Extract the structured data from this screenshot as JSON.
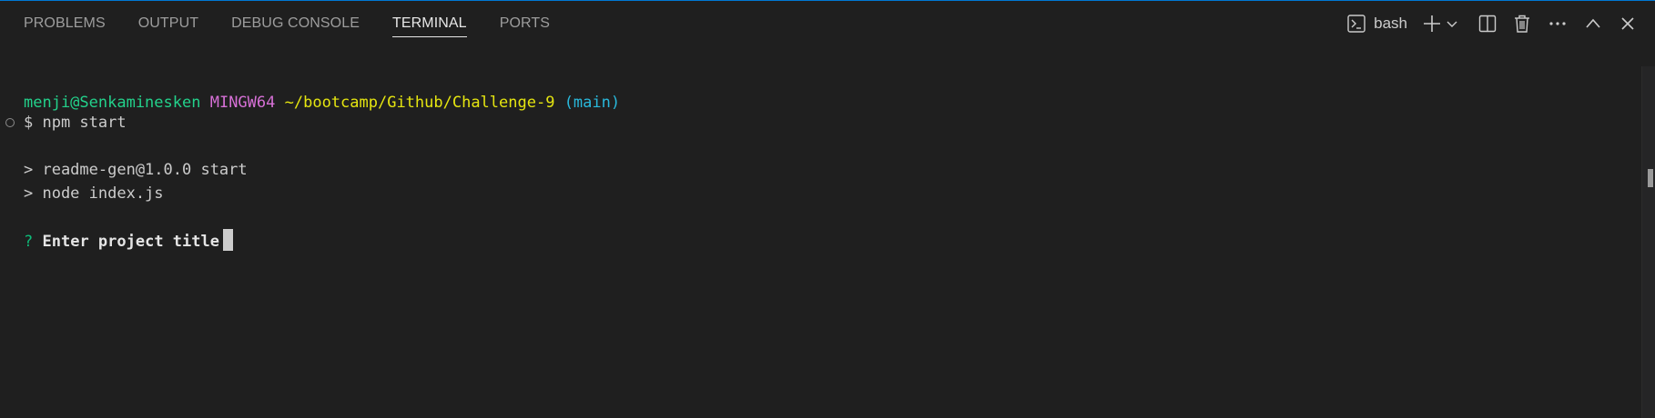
{
  "tabs": [
    {
      "label": "PROBLEMS",
      "active": false
    },
    {
      "label": "OUTPUT",
      "active": false
    },
    {
      "label": "DEBUG CONSOLE",
      "active": false
    },
    {
      "label": "TERMINAL",
      "active": true
    },
    {
      "label": "PORTS",
      "active": false
    }
  ],
  "actions": {
    "shell_icon": "terminal-icon",
    "shell_label": "bash",
    "new_terminal_icon": "plus-icon",
    "launch_profile_icon": "chevron-down-icon",
    "split_icon": "split-icon",
    "kill_icon": "trash-icon",
    "more_icon": "ellipsis-icon",
    "maximize_icon": "chevron-up-icon",
    "close_icon": "close-icon"
  },
  "terminal": {
    "prompt": {
      "user_host": "menji@Senkaminesken",
      "system": "MINGW64",
      "path": "~/bootcamp/Github/Challenge-9",
      "branch": "(main)"
    },
    "command": "$ npm start",
    "output_line_1": "> readme-gen@1.0.0 start",
    "output_line_2": "> node index.js",
    "question_mark": "?",
    "question": "Enter project title"
  },
  "colors": {
    "background": "#1f1f1f",
    "accent": "#0078d4",
    "user_host": "#23d18b",
    "system": "#d670d6",
    "path": "#e5e510",
    "branch": "#29b8db",
    "question_mark": "#0dbc79"
  }
}
